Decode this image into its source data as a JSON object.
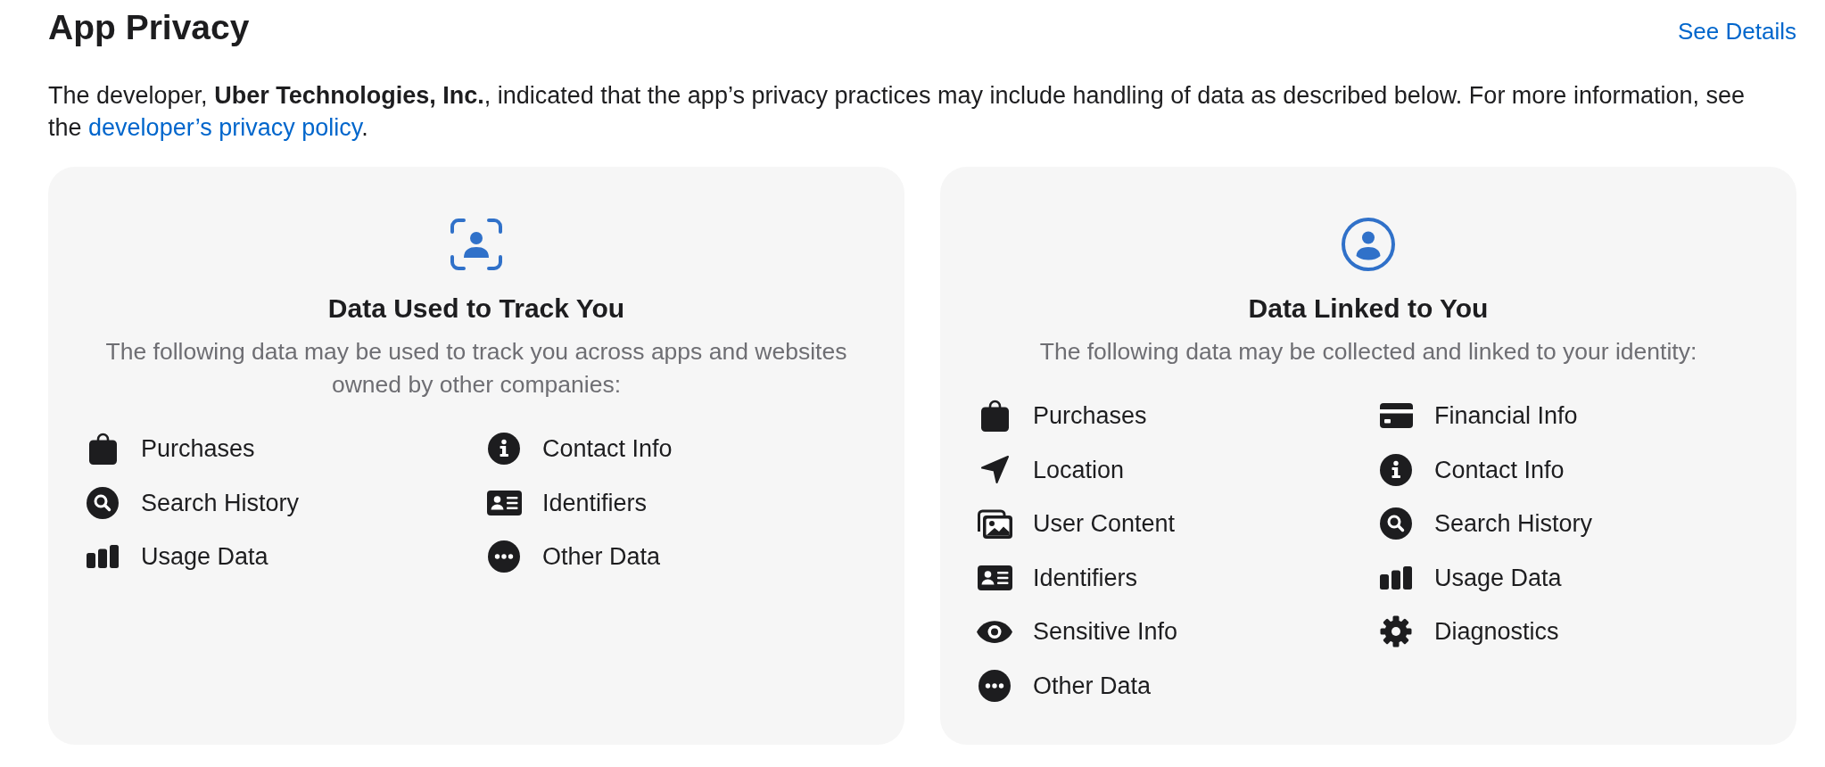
{
  "header": {
    "title": "App Privacy",
    "link": "See Details"
  },
  "notice": {
    "text": "The developer, **Uber Technologies, Inc.**, indicated that the app’s privacy practices may include handling of data as described below. For more information, see the",
    "link": "developer’s privacy policy",
    "after": "."
  },
  "cards": [
    {
      "kind": "track",
      "title": "Data Used to Track You",
      "description": "The following data may be used to track you across apps and websites owned by other companies:",
      "items": [
        {
          "kind": "bag",
          "label": "Purchases"
        },
        {
          "kind": "info",
          "label": "Contact Info"
        },
        {
          "kind": "search",
          "label": "Search History"
        },
        {
          "kind": "idcard",
          "label": "Identifiers"
        },
        {
          "kind": "bars",
          "label": "Usage Data"
        },
        {
          "kind": "dots",
          "label": "Other Data"
        }
      ]
    },
    {
      "kind": "linked",
      "title": "Data Linked to You",
      "description": "The following data may be collected and linked to your identity:",
      "items": [
        {
          "kind": "bag",
          "label": "Purchases"
        },
        {
          "kind": "card",
          "label": "Financial Info"
        },
        {
          "kind": "arrow",
          "label": "Location"
        },
        {
          "kind": "info",
          "label": "Contact Info"
        },
        {
          "kind": "photos",
          "label": "User Content"
        },
        {
          "kind": "search",
          "label": "Search History"
        },
        {
          "kind": "idcard",
          "label": "Identifiers"
        },
        {
          "kind": "bars",
          "label": "Usage Data"
        },
        {
          "kind": "eye",
          "label": "Sensitive Info"
        },
        {
          "kind": "gear",
          "label": "Diagnostics"
        },
        {
          "kind": "dots",
          "label": "Other Data"
        }
      ]
    }
  ]
}
